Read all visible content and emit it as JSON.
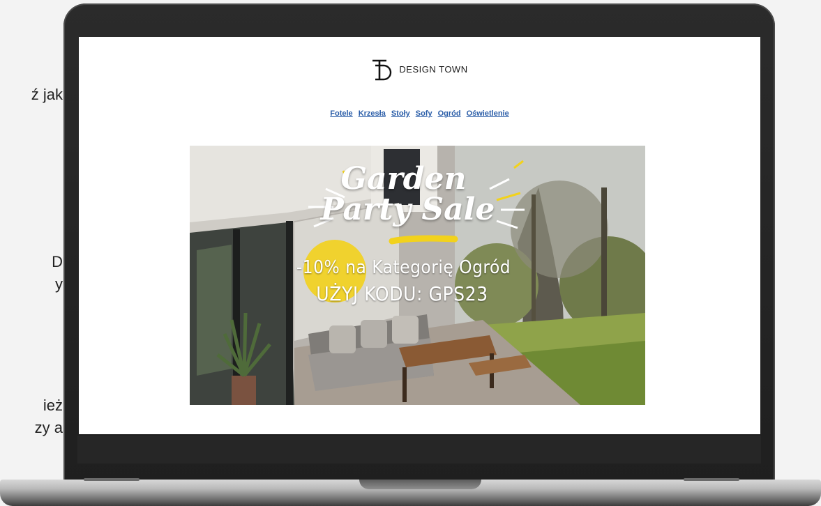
{
  "left_fragments": [
    "ź jak",
    "D",
    "y",
    "ież",
    "zy a"
  ],
  "email": {
    "brand_name": "DESIGN TOWN",
    "nav": [
      "Fotele",
      "Krzesła",
      "Stoły",
      "Sofy",
      "Ogród",
      "Oświetlenie"
    ],
    "hero": {
      "title_line1": "Garden",
      "title_line2": "Party Sale",
      "promo_line1": "-10% na Kategorię Ogród",
      "promo_line2": "UŻYJ KODU: GPS23"
    }
  },
  "colors": {
    "accent_yellow": "#f2d21c",
    "nav_link": "#2a5da8",
    "laptop_body": "#262626"
  }
}
